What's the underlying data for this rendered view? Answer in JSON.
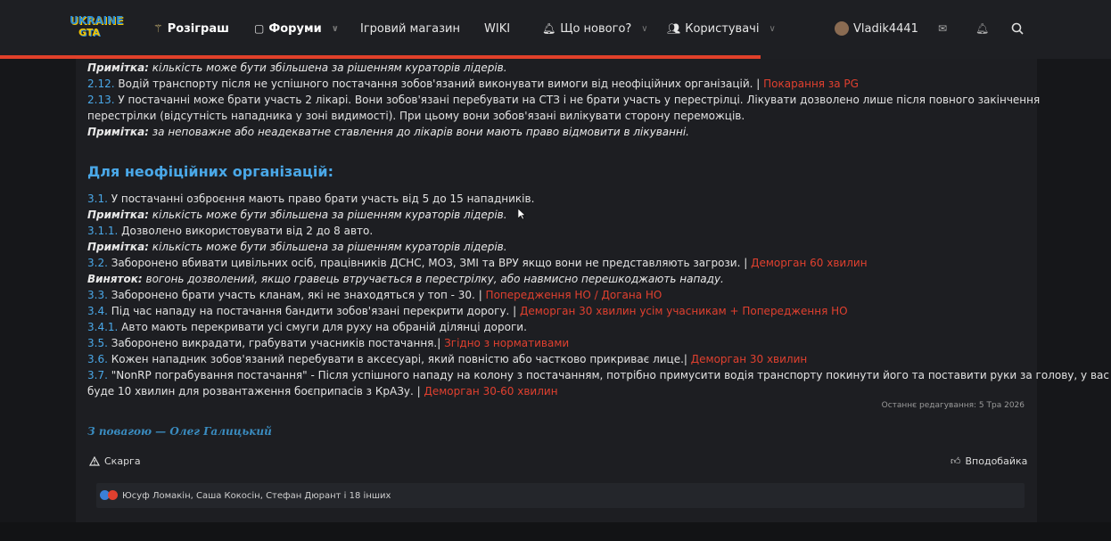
{
  "nav": {
    "logo_line1": "UKRAINE",
    "logo_line2": "GTA",
    "giveaway": "Розіграш",
    "forums": "Форуми",
    "shop": "Ігровий магазин",
    "wiki": "WIKI",
    "whats_new": "Що нового?",
    "users": "Користувачі",
    "username": "Vladik4441"
  },
  "colors": {
    "accent_blue": "#4aa8e8",
    "penalty_red": "#e0402f",
    "progress": "#e1402a"
  },
  "rules_top": [
    {
      "num": "",
      "note_label": "Примітка:",
      "note": " кількість може бути збільшена за рішенням кураторів лідерів."
    },
    {
      "num": "2.12.",
      "text": " Водій транспорту після не успішного постачання зобов'язаний виконувати вимоги від неофіційних організацій. | ",
      "penalty": "Покарання за PG"
    },
    {
      "num": "2.13.",
      "text": " У постачанні може брати участь 2 лікарі. Вони зобов'язані перебувати на СТЗ і не брати участь у перестрілці. Лікувати дозволено лише після повного закінчення",
      "penalty": ""
    },
    {
      "num": "",
      "text": "перестрілки (відсутність нападника у зоні видимості). При цьому вони зобов'язані вилікувати сторону переможців.",
      "penalty": ""
    },
    {
      "num": "",
      "note_label": "Примітка:",
      "note": " за неповажне або неадекватне ставлення до лікарів вони мають право відмовити в лікуванні."
    }
  ],
  "section_heading": "Для неофіційних організацій:",
  "rules_unofficial": [
    {
      "num": "3.1.",
      "text": " У постачанні озброєння мають право брати участь від 5 до 15 нападників.",
      "penalty": ""
    },
    {
      "num": "",
      "note_label": "Примітка:",
      "note": " кількість може бути збільшена за рішенням кураторів лідерів."
    },
    {
      "num": "3.1.1.",
      "text": " Дозволено використовувати від 2 до 8 авто.",
      "penalty": ""
    },
    {
      "num": "",
      "note_label": "Примітка:",
      "note": " кількість може бути збільшена за рішенням кураторів лідерів."
    },
    {
      "num": "3.2.",
      "text": " Заборонено вбивати цивільних осіб, працівників ДСНС, МОЗ, ЗМІ та ВРУ якщо вони не представляють загрози. | ",
      "penalty": "Деморган 60 хвилин"
    },
    {
      "num": "",
      "note_label": "Виняток:",
      "note": " вогонь дозволений, якщо гравець втручається в перестрілку, або навмисно перешкоджають нападу."
    },
    {
      "num": "3.3.",
      "text": " Заборонено брати участь кланам, які не знаходяться у топ - 30. | ",
      "penalty": "Попередження НО / Догана НО"
    },
    {
      "num": "3.4.",
      "text": " Під час нападу на постачання бандити зобов'язані перекрити дорогу. | ",
      "penalty": "Деморган 30 хвилин усім учасникам + Попередження НО"
    },
    {
      "num": "3.4.1.",
      "text": " Авто мають перекривати усі смуги для руху на обраній ділянці дороги.",
      "penalty": ""
    },
    {
      "num": "3.5.",
      "text": " Заборонено викрадати, грабувати учасників постачання.| ",
      "penalty": "Згідно з нормативами"
    },
    {
      "num": "3.6.",
      "text": " Кожен нападник зобов'язаний перебувати в аксесуарі, який повністю або частково прикриває лице.| ",
      "penalty": "Деморган 30 хвилин"
    },
    {
      "num": "3.7.",
      "text": " \"NonRP пограбування постачання\" - Після успішного нападу на колону з постачанням, потрібно примусити водія транспорту покинути його та поставити руки за голову, у вас",
      "penalty": ""
    },
    {
      "num": "",
      "text": "буде 10 хвилин для розвантаження боєприпасів з КрАЗу. | ",
      "penalty": "Деморган 30-60 хвилин"
    }
  ],
  "edited": "Останнє редагування: 5 Тра 2026",
  "signature": "З повагою — Олег Галицький",
  "actions": {
    "report": "Скарга",
    "like": "Вподобайка"
  },
  "reactions_text": "Юсуф Ломакін, Саша Кокосін, Стефан Дюрант і 18 інших"
}
